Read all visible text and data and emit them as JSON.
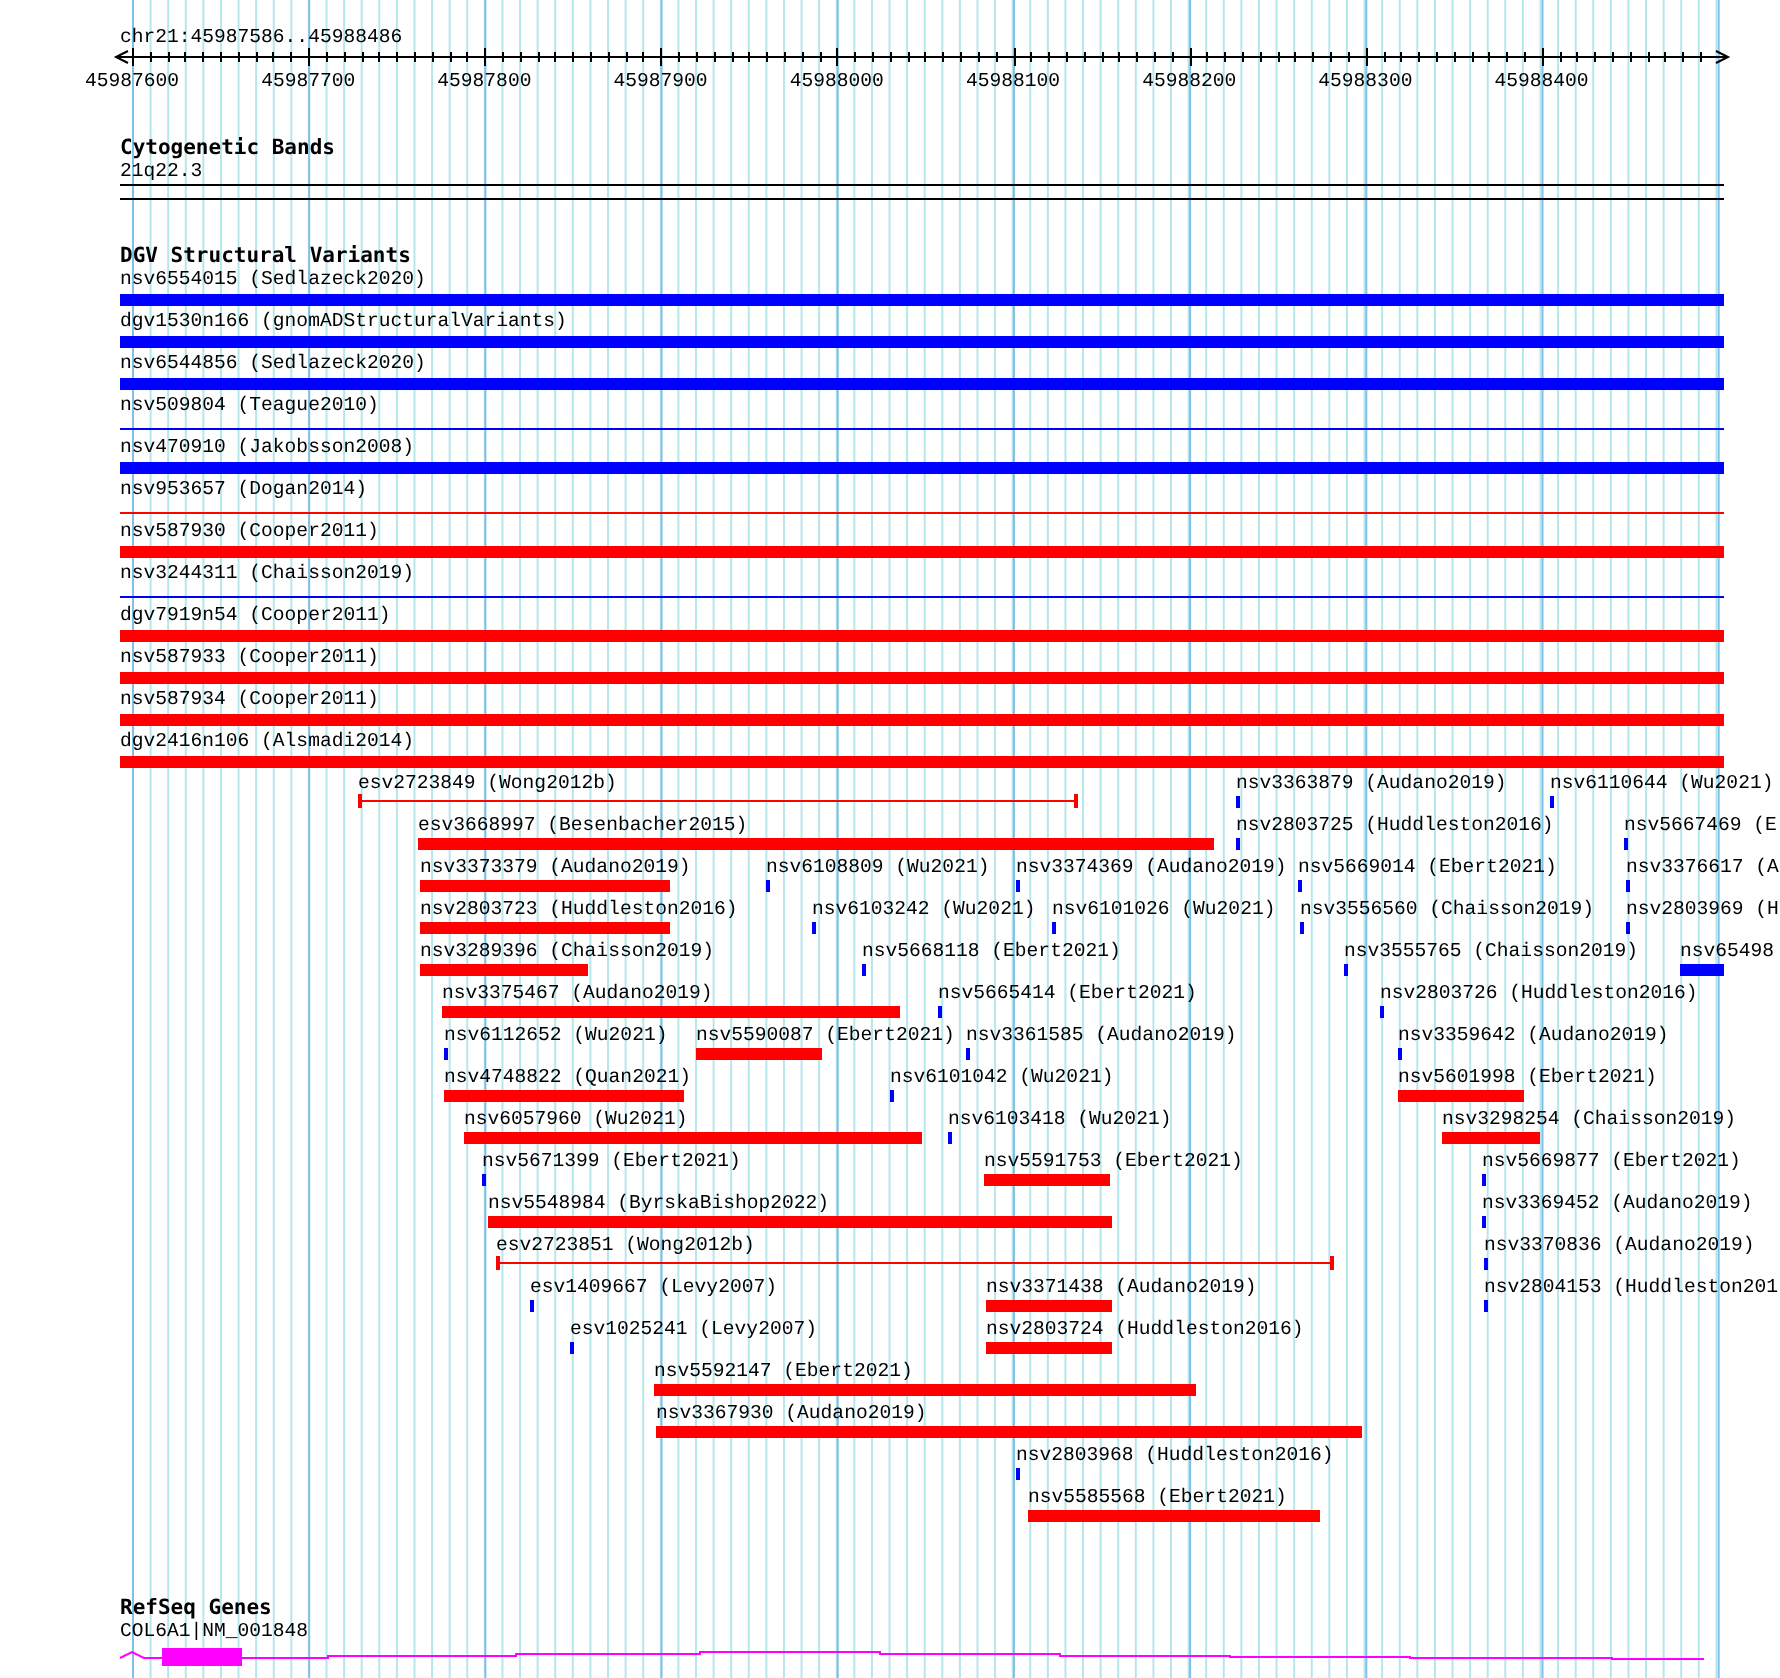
{
  "ruler": {
    "position": "chr21:45987586..45988486",
    "ticks": [
      "45987600",
      "45987700",
      "45987800",
      "45987900",
      "45988000",
      "45988100",
      "45988200",
      "45988300",
      "45988400"
    ]
  },
  "cytogenetic_bands": {
    "title": "Cytogenetic Bands",
    "band": "21q22.3"
  },
  "dgv": {
    "title": "DGV Structural Variants",
    "full_rows": [
      {
        "label": "nsv6554015 (Sedlazeck2020)",
        "color": "#0000ff",
        "kind": "bar"
      },
      {
        "label": "dgv1530n166 (gnomADStructuralVariants)",
        "color": "#0000ff",
        "kind": "bar"
      },
      {
        "label": "nsv6544856 (Sedlazeck2020)",
        "color": "#0000ff",
        "kind": "bar"
      },
      {
        "label": "nsv509804 (Teague2010)",
        "color": "#0000ff",
        "kind": "line"
      },
      {
        "label": "nsv470910 (Jakobsson2008)",
        "color": "#0000ff",
        "kind": "bar"
      },
      {
        "label": "nsv953657 (Dogan2014)",
        "color": "#ff0000",
        "kind": "line"
      },
      {
        "label": "nsv587930 (Cooper2011)",
        "color": "#ff0000",
        "kind": "bar"
      },
      {
        "label": "nsv3244311 (Chaisson2019)",
        "color": "#0000ff",
        "kind": "line"
      },
      {
        "label": "dgv7919n54 (Cooper2011)",
        "color": "#ff0000",
        "kind": "bar"
      },
      {
        "label": "nsv587933 (Cooper2011)",
        "color": "#ff0000",
        "kind": "bar"
      },
      {
        "label": "nsv587934 (Cooper2011)",
        "color": "#ff0000",
        "kind": "bar"
      },
      {
        "label": "dgv2416n106 (Alsmadi2014)",
        "color": "#ff0000",
        "kind": "bar"
      }
    ],
    "packed": [
      {
        "label": "esv2723849 (Wong2012b)",
        "color": "#ff0000",
        "kind": "span"
      },
      {
        "label": "nsv3363879 (Audano2019)",
        "color": "#0000ff",
        "kind": "bar"
      },
      {
        "label": "nsv6110644 (Wu2021)",
        "color": "#0000ff",
        "kind": "bar"
      },
      {
        "label": "esv3668997 (Besenbacher2015)",
        "color": "#ff0000",
        "kind": "bar"
      },
      {
        "label": "nsv2803725 (Huddleston2016)",
        "color": "#0000ff",
        "kind": "bar"
      },
      {
        "label": "nsv5667469 (E",
        "color": "#0000ff",
        "kind": "bar"
      },
      {
        "label": "nsv3373379 (Audano2019)",
        "color": "#ff0000",
        "kind": "bar"
      },
      {
        "label": "nsv6108809 (Wu2021)",
        "color": "#0000ff",
        "kind": "bar"
      },
      {
        "label": "nsv3374369 (Audano2019)",
        "color": "#0000ff",
        "kind": "bar"
      },
      {
        "label": "nsv5669014 (Ebert2021)",
        "color": "#0000ff",
        "kind": "bar"
      },
      {
        "label": "nsv3376617 (A",
        "color": "#0000ff",
        "kind": "bar"
      },
      {
        "label": "nsv2803723 (Huddleston2016)",
        "color": "#ff0000",
        "kind": "bar"
      },
      {
        "label": "nsv6103242 (Wu2021)",
        "color": "#0000ff",
        "kind": "bar"
      },
      {
        "label": "nsv6101026 (Wu2021)",
        "color": "#0000ff",
        "kind": "bar"
      },
      {
        "label": "nsv3556560 (Chaisson2019)",
        "color": "#0000ff",
        "kind": "bar"
      },
      {
        "label": "nsv2803969 (H",
        "color": "#0000ff",
        "kind": "bar"
      },
      {
        "label": "nsv3289396 (Chaisson2019)",
        "color": "#ff0000",
        "kind": "bar"
      },
      {
        "label": "nsv5668118 (Ebert2021)",
        "color": "#0000ff",
        "kind": "bar"
      },
      {
        "label": "nsv3555765 (Chaisson2019)",
        "color": "#0000ff",
        "kind": "bar"
      },
      {
        "label": "nsv65498",
        "color": "#0000ff",
        "kind": "bar"
      },
      {
        "label": "nsv3375467 (Audano2019)",
        "color": "#ff0000",
        "kind": "bar"
      },
      {
        "label": "nsv5665414 (Ebert2021)",
        "color": "#0000ff",
        "kind": "bar"
      },
      {
        "label": "nsv2803726 (Huddleston2016)",
        "color": "#0000ff",
        "kind": "bar"
      },
      {
        "label": "nsv6112652 (Wu2021)",
        "color": "#0000ff",
        "kind": "bar"
      },
      {
        "label": "nsv5590087 (Ebert2021)",
        "color": "#ff0000",
        "kind": "bar"
      },
      {
        "label": "nsv3361585 (Audano2019)",
        "color": "#0000ff",
        "kind": "bar"
      },
      {
        "label": "nsv3359642 (Audano2019)",
        "color": "#0000ff",
        "kind": "bar"
      },
      {
        "label": "nsv4748822 (Quan2021)",
        "color": "#ff0000",
        "kind": "bar"
      },
      {
        "label": "nsv6101042 (Wu2021)",
        "color": "#0000ff",
        "kind": "bar"
      },
      {
        "label": "nsv5601998 (Ebert2021)",
        "color": "#ff0000",
        "kind": "bar"
      },
      {
        "label": "nsv6057960 (Wu2021)",
        "color": "#ff0000",
        "kind": "bar"
      },
      {
        "label": "nsv6103418 (Wu2021)",
        "color": "#0000ff",
        "kind": "bar"
      },
      {
        "label": "nsv3298254 (Chaisson2019)",
        "color": "#ff0000",
        "kind": "bar"
      },
      {
        "label": "nsv5671399 (Ebert2021)",
        "color": "#0000ff",
        "kind": "bar"
      },
      {
        "label": "nsv5591753 (Ebert2021)",
        "color": "#ff0000",
        "kind": "bar"
      },
      {
        "label": "nsv5669877 (Ebert2021)",
        "color": "#0000ff",
        "kind": "bar"
      },
      {
        "label": "nsv5548984 (ByrskaBishop2022)",
        "color": "#ff0000",
        "kind": "bar"
      },
      {
        "label": "nsv3369452 (Audano2019)",
        "color": "#0000ff",
        "kind": "bar"
      },
      {
        "label": "esv2723851 (Wong2012b)",
        "color": "#ff0000",
        "kind": "span"
      },
      {
        "label": "nsv3370836 (Audano2019)",
        "color": "#0000ff",
        "kind": "bar"
      },
      {
        "label": "esv1409667 (Levy2007)",
        "color": "#0000ff",
        "kind": "bar"
      },
      {
        "label": "nsv3371438 (Audano2019)",
        "color": "#ff0000",
        "kind": "bar"
      },
      {
        "label": "nsv2804153 (Huddleston201",
        "color": "#0000ff",
        "kind": "bar"
      },
      {
        "label": "esv1025241 (Levy2007)",
        "color": "#0000ff",
        "kind": "bar"
      },
      {
        "label": "nsv2803724 (Huddleston2016)",
        "color": "#ff0000",
        "kind": "bar"
      },
      {
        "label": "nsv5592147 (Ebert2021)",
        "color": "#ff0000",
        "kind": "bar"
      },
      {
        "label": "nsv3367930 (Audano2019)",
        "color": "#ff0000",
        "kind": "bar"
      },
      {
        "label": "nsv2803968 (Huddleston2016)",
        "color": "#0000ff",
        "kind": "bar"
      },
      {
        "label": "nsv5585568 (Ebert2021)",
        "color": "#ff0000",
        "kind": "bar"
      }
    ]
  },
  "refseq": {
    "title": "RefSeq Genes",
    "gene": "COL6A1|NM_001848"
  }
}
